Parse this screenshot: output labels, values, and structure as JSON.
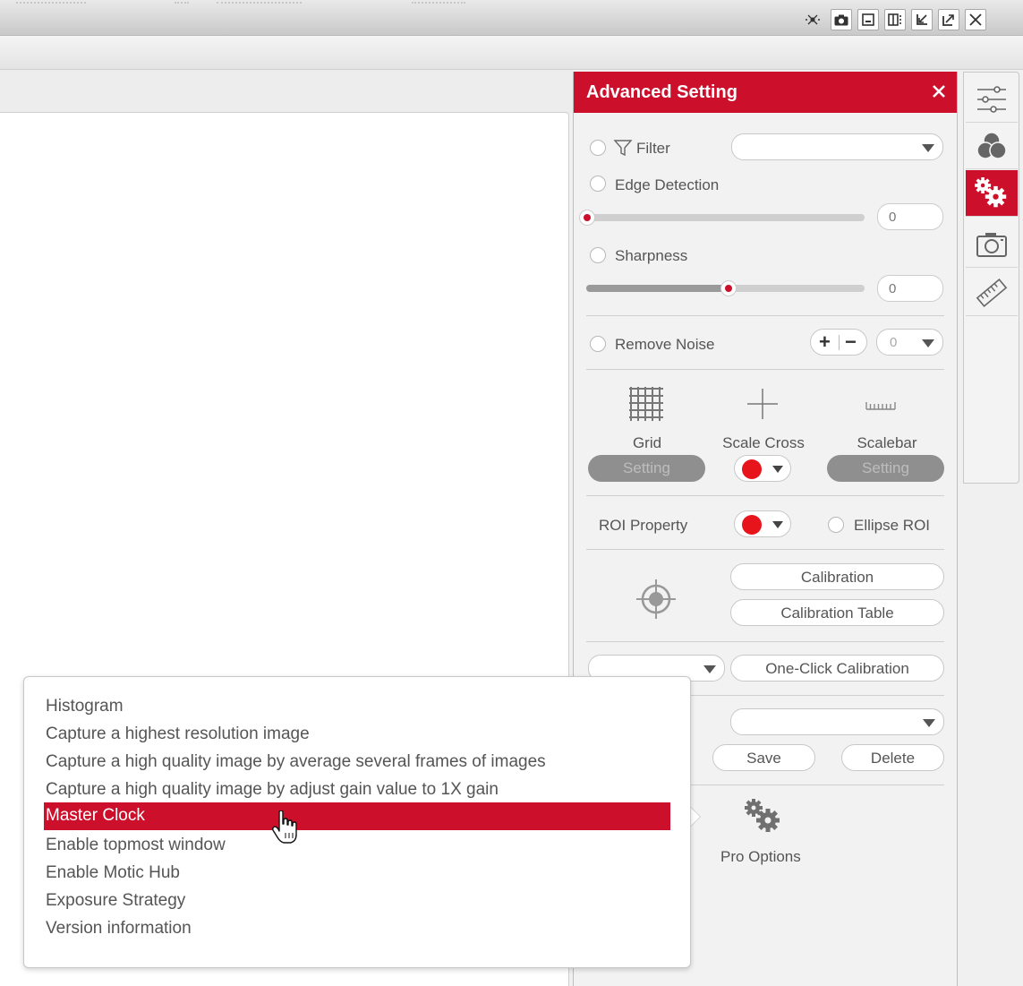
{
  "window": {
    "controls": [
      "audio-icon",
      "camera-icon",
      "minimize-icon",
      "layout-icon",
      "restore-icon",
      "maximize-icon",
      "close-icon"
    ]
  },
  "panel": {
    "title": "Advanced Setting",
    "filter": {
      "label": "Filter",
      "value": ""
    },
    "edge_detection": {
      "label": "Edge Detection",
      "value": "0",
      "level": 0
    },
    "sharpness": {
      "label": "Sharpness",
      "value": "0",
      "level": 0.5
    },
    "remove_noise": {
      "label": "Remove Noise",
      "plus": "+",
      "minus": "−",
      "value": "0"
    },
    "overlays": {
      "grid": {
        "label": "Grid",
        "button": "Setting"
      },
      "scale_cross": {
        "label": "Scale Cross",
        "color": "#e8141c"
      },
      "scalebar": {
        "label": "Scalebar",
        "button": "Setting"
      }
    },
    "roi": {
      "label": "ROI Property",
      "color": "#e8141c",
      "ellipse_label": "Ellipse ROI"
    },
    "calibration": {
      "calibration_label": "Calibration",
      "table_label": "Calibration Table"
    },
    "one_click": {
      "select_value": "",
      "label": "One-Click Calibration"
    },
    "profile": {
      "select_value": "",
      "save_label": "Save",
      "delete_label": "Delete"
    },
    "pro_options": {
      "label": "Pro Options"
    }
  },
  "side_tabs": [
    {
      "icon": "sliders-icon",
      "active": false
    },
    {
      "icon": "color-circles-icon",
      "active": false
    },
    {
      "icon": "gears-icon",
      "active": true
    },
    {
      "icon": "camera-icon",
      "active": false
    },
    {
      "icon": "ruler-icon",
      "active": false
    }
  ],
  "popup_menu": {
    "items": [
      "Histogram",
      "Capture a highest resolution image",
      "Capture a high quality image by average several frames of images",
      "Capture a high quality image by adjust gain value to 1X gain",
      "Master Clock",
      "Enable topmost window",
      "Enable Motic Hub",
      "Exposure Strategy",
      "Version information"
    ],
    "highlighted": "Master Clock"
  },
  "colors": {
    "accent": "#cc0f2b",
    "marker": "#e8141c"
  }
}
